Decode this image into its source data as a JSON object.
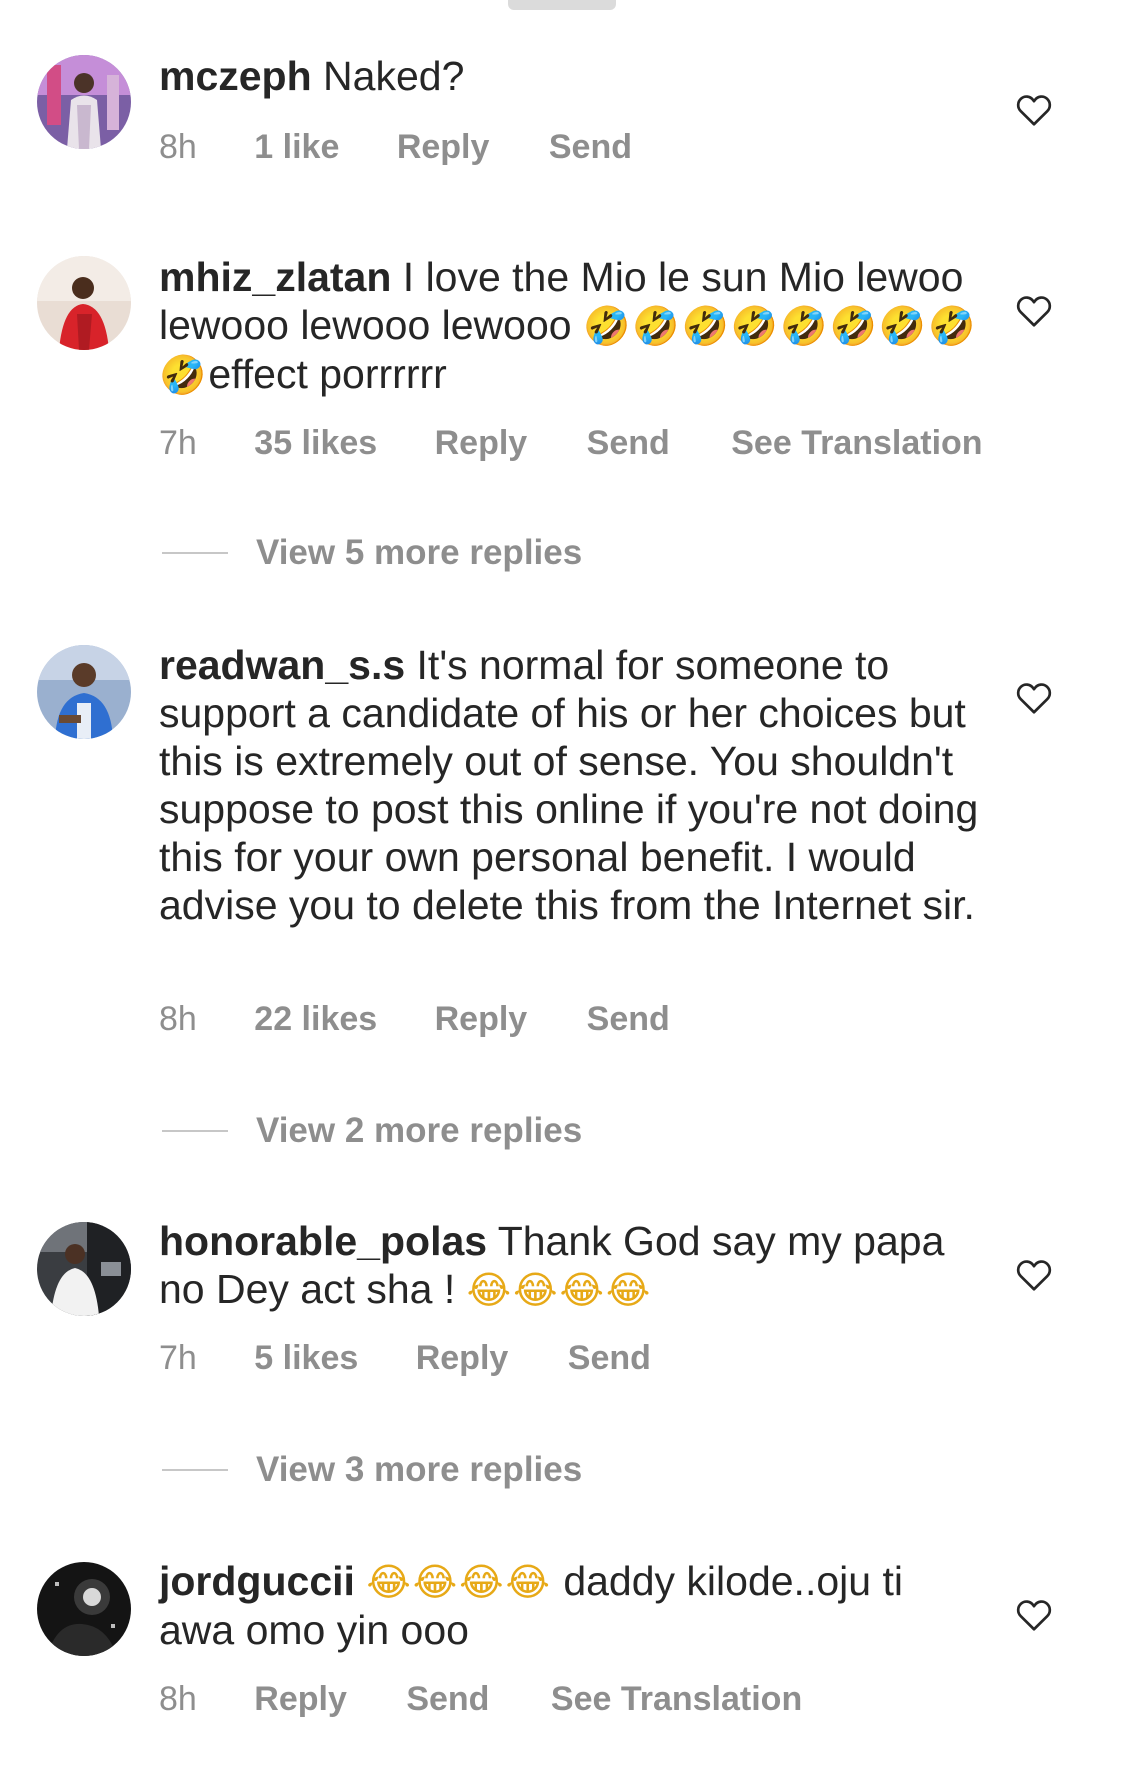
{
  "comments": [
    {
      "username": "mczeph",
      "text": " Naked?",
      "emoji_after": "",
      "tail_text": "",
      "time": "8h",
      "likes": "1 like",
      "reply_label": "Reply",
      "send_label": "Send",
      "translation_label": "",
      "view_replies": ""
    },
    {
      "username": "mhiz_zlatan",
      "text": " I love the Mio le sun Mio lewoo lewooo lewooo lewooo ",
      "emoji_after": "🤣🤣🤣🤣🤣🤣🤣🤣🤣",
      "tail_text": "effect porrrrrr",
      "time": "7h",
      "likes": "35 likes",
      "reply_label": "Reply",
      "send_label": "Send",
      "translation_label": "See Translation",
      "view_replies": "View 5 more replies"
    },
    {
      "username": "readwan_s.s",
      "text": " It's normal for someone to support a candidate of his or her choices but this is extremely out of sense. You shouldn't suppose to post this online if you're not doing this for your own personal benefit.  I would advise you to delete this from the Internet sir.",
      "emoji_after": "",
      "tail_text": "",
      "time": "8h",
      "likes": "22 likes",
      "reply_label": "Reply",
      "send_label": "Send",
      "translation_label": "",
      "view_replies": "View 2 more replies"
    },
    {
      "username": "honorable_polas",
      "text": " Thank God say my papa no Dey act sha ! ",
      "emoji_after": "😂😂😂😂",
      "tail_text": "",
      "time": "7h",
      "likes": "5 likes",
      "reply_label": "Reply",
      "send_label": "Send",
      "translation_label": "",
      "view_replies": "View 3 more replies"
    },
    {
      "username": "jordguccii",
      "text": " ",
      "emoji_after": "😂😂😂😂",
      "tail_text": " daddy kilode..oju ti awa omo yin ooo",
      "time": "8h",
      "likes": "",
      "reply_label": "Reply",
      "send_label": "Send",
      "translation_label": "See Translation",
      "view_replies": ""
    }
  ]
}
